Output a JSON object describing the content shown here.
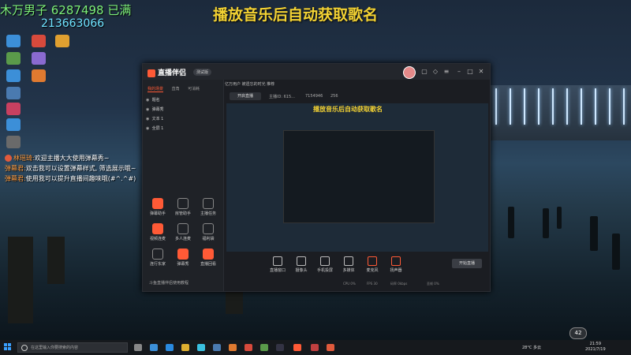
{
  "overlay": {
    "title": "播放音乐后自动获取歌名",
    "top_left": "木万男子 6287498 已满",
    "number": "213663066"
  },
  "chat": [
    {
      "name": "林瑶琦:",
      "text": "欢迎主播大大使用弹幕秀~"
    },
    {
      "name": "弹幕君:",
      "text": "双击我可以设置弹幕样式, 筛选展示哦~"
    },
    {
      "name": "弹幕君:",
      "text": "使用我可以提升直播间趣味哦(#^.^#)"
    }
  ],
  "app": {
    "logo": "直播伴侣",
    "version_badge": "测试版",
    "tabs": [
      "我的场景",
      "直角",
      "可消耗"
    ],
    "scenes": [
      "题名",
      "弹幕秀",
      "文本 1",
      "全屏 1"
    ],
    "tools": [
      "弹幕助手",
      "房管助手",
      "主播任务",
      "视频连麦",
      "多人连麦",
      "福利袋",
      "连行东家",
      "弹幕秀",
      "直播回看"
    ],
    "top_info": "亿万用户  被遗忘的时光  推荐",
    "live_label": "开启直播",
    "stats": [
      "主播ID: 615...",
      "7154946",
      "256"
    ],
    "preview_title": "播放音乐后自动获取歌名",
    "bottom_tools": [
      "直播窗口",
      "摄像头",
      "手机投屏",
      "多媒体",
      "麦克风",
      "扬声器"
    ],
    "start_label": "开始直播",
    "status_items": [
      "CPU 0%",
      "FPS 30",
      "码率 0kbps",
      "丢帧 0%"
    ],
    "footer_hint": "斗鱼直播伴侣使用教程"
  },
  "taskbar": {
    "search_placeholder": "在这里输入你要搜索的内容",
    "weather": "28°C 多云",
    "time": "21:59",
    "date": "2021/7/19",
    "badge": "42"
  },
  "colors": {
    "accent": "#ff5a36",
    "overlay_yellow": "#f3d233",
    "overlay_green": "#7df07a",
    "overlay_cyan": "#6fe3ff"
  }
}
